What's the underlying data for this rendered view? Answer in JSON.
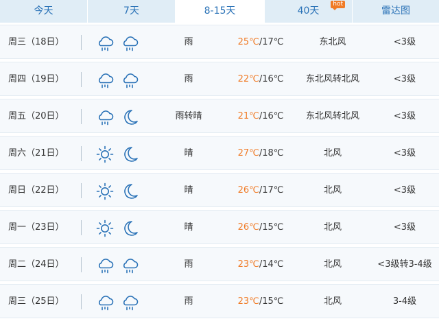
{
  "tabs": [
    {
      "label": "今天",
      "active": false
    },
    {
      "label": "7天",
      "active": false
    },
    {
      "label": "8-15天",
      "active": true
    },
    {
      "label": "40天",
      "active": false,
      "badge": "hot"
    },
    {
      "label": "雷达图",
      "active": false
    }
  ],
  "colors": {
    "accent": "#2a72b7",
    "high_temp": "#f07b26",
    "row_bg": "#f6f9fc",
    "tab_bg": "#e0edf6"
  },
  "forecast": [
    {
      "day": "周三（18日）",
      "icons": [
        "rain-cloud-icon",
        "rain-cloud-icon"
      ],
      "desc": "雨",
      "high": "25℃",
      "low": "/17℃",
      "wind": "东北风",
      "level": "<3级"
    },
    {
      "day": "周四（19日）",
      "icons": [
        "rain-cloud-icon",
        "rain-cloud-icon"
      ],
      "desc": "雨",
      "high": "22℃",
      "low": "/16℃",
      "wind": "东北风转北风",
      "level": "<3级"
    },
    {
      "day": "周五（20日）",
      "icons": [
        "rain-cloud-icon",
        "moon-icon"
      ],
      "desc": "雨转晴",
      "high": "21℃",
      "low": "/16℃",
      "wind": "东北风转北风",
      "level": "<3级"
    },
    {
      "day": "周六（21日）",
      "icons": [
        "sun-icon",
        "moon-icon"
      ],
      "desc": "晴",
      "high": "27℃",
      "low": "/18℃",
      "wind": "北风",
      "level": "<3级"
    },
    {
      "day": "周日（22日）",
      "icons": [
        "sun-icon",
        "moon-icon"
      ],
      "desc": "晴",
      "high": "26℃",
      "low": "/17℃",
      "wind": "北风",
      "level": "<3级"
    },
    {
      "day": "周一（23日）",
      "icons": [
        "sun-icon",
        "moon-icon"
      ],
      "desc": "晴",
      "high": "26℃",
      "low": "/15℃",
      "wind": "北风",
      "level": "<3级"
    },
    {
      "day": "周二（24日）",
      "icons": [
        "rain-cloud-icon",
        "rain-cloud-icon"
      ],
      "desc": "雨",
      "high": "23℃",
      "low": "/14℃",
      "wind": "北风",
      "level": "<3级转3-4级"
    },
    {
      "day": "周三（25日）",
      "icons": [
        "rain-cloud-icon",
        "rain-cloud-icon"
      ],
      "desc": "雨",
      "high": "23℃",
      "low": "/15℃",
      "wind": "北风",
      "level": "3-4级"
    }
  ]
}
